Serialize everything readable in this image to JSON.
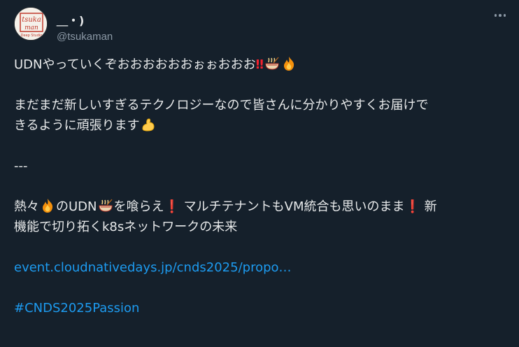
{
  "user": {
    "display_name": "＿・)",
    "handle": "@tsukaman",
    "avatar_text_top": "tsuka",
    "avatar_text_mid": "man",
    "avatar_text_bottom": "Deep Studio"
  },
  "tweet": {
    "line1_text": "UDNやっていくぞおおおおおおぉぉおおお",
    "line2_text": "まだまだ新しいすぎるテクノロジーなので皆さんに分かりやすくお届けで",
    "line3_text": "きるように頑張ります",
    "separator": "---",
    "line5_a": "熱々",
    "line5_b": "のUDN",
    "line5_c": "を喰らえ",
    "line5_d": " マルチテナントもVM統合も思いのまま",
    "line5_e": " 新",
    "line6_text": "機能で切り拓くk8sネットワークの未来",
    "link_text": "event.cloudnativedays.jp/cnds2025/propo…",
    "hashtag": "#CNDS2025Passion",
    "double_excl": "‼",
    "single_excl": "❗"
  },
  "colors": {
    "background": "#15202b",
    "text": "#e7e9ea",
    "secondary": "#8b98a5",
    "link": "#1d9bf0"
  },
  "icons": [
    "avatar-logo",
    "more-icon",
    "ramen-emoji",
    "fire-emoji",
    "flexed-biceps-emoji",
    "exclamation-emoji"
  ]
}
